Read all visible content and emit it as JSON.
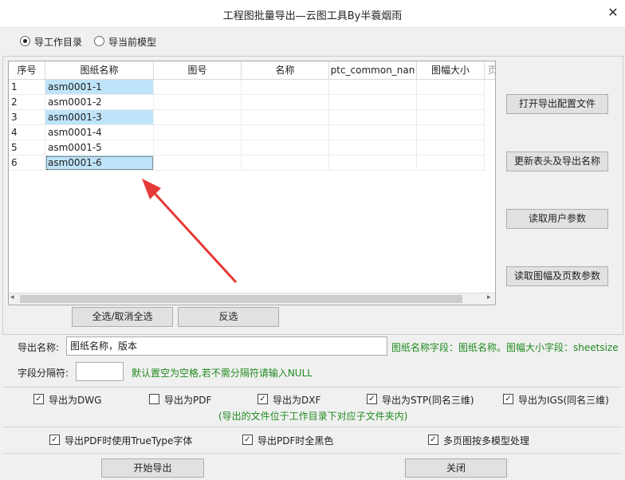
{
  "window": {
    "title": "工程图批量导出—云图工具By半蓑烟雨"
  },
  "mode": {
    "option_workdir": "导工作目录",
    "option_current": "导当前模型",
    "selected": "导工作目录"
  },
  "table": {
    "columns": [
      "序号",
      "图纸名称",
      "图号",
      "名称",
      "ptc_common_nan",
      "图幅大小",
      "页"
    ],
    "rows": [
      {
        "no": "1",
        "name": "asm0001-1",
        "selected": true
      },
      {
        "no": "2",
        "name": "asm0001-2",
        "selected": false
      },
      {
        "no": "3",
        "name": "asm0001-3",
        "selected": true
      },
      {
        "no": "4",
        "name": "asm0001-4",
        "selected": false
      },
      {
        "no": "5",
        "name": "asm0001-5",
        "selected": false
      },
      {
        "no": "6",
        "name": "asm0001-6",
        "selected": true
      }
    ]
  },
  "side_buttons": {
    "open_config": "打开导出配置文件",
    "update_header": "更新表头及导出名称",
    "read_user_params": "读取用户参数",
    "read_sheet_params": "读取图幅及页数参数"
  },
  "table_buttons": {
    "select_all": "全选/取消全选",
    "invert": "反选"
  },
  "export_name": {
    "label": "导出名称:",
    "value": "图纸名称，版本",
    "hint": "图纸名称字段：图纸名称。图幅大小字段：sheetsize"
  },
  "separator": {
    "label": "字段分隔符:",
    "value": "",
    "hint": "默认置空为空格,若不需分隔符请输入NULL"
  },
  "export_options": {
    "dwg": {
      "label": "导出为DWG",
      "checked": true
    },
    "pdf": {
      "label": "导出为PDF",
      "checked": false
    },
    "dxf": {
      "label": "导出为DXF",
      "checked": true
    },
    "stp": {
      "label": "导出为STP(同名三维)",
      "checked": true
    },
    "igs": {
      "label": "导出为IGS(同名三维)",
      "checked": true
    },
    "note": "(导出的文件位于工作目录下对应子文件夹内)"
  },
  "pdf_options": {
    "truetype": {
      "label": "导出PDF时使用TrueType字体",
      "checked": true
    },
    "all_black": {
      "label": "导出PDF时全黑色",
      "checked": true
    },
    "multi_page": {
      "label": "多页图按多模型处理",
      "checked": true
    }
  },
  "footer": {
    "start": "开始导出",
    "close": "关闭"
  },
  "colors": {
    "selection": "#bfe4f9",
    "hint_green": "#1f8a1f",
    "arrow": "#e53935"
  }
}
